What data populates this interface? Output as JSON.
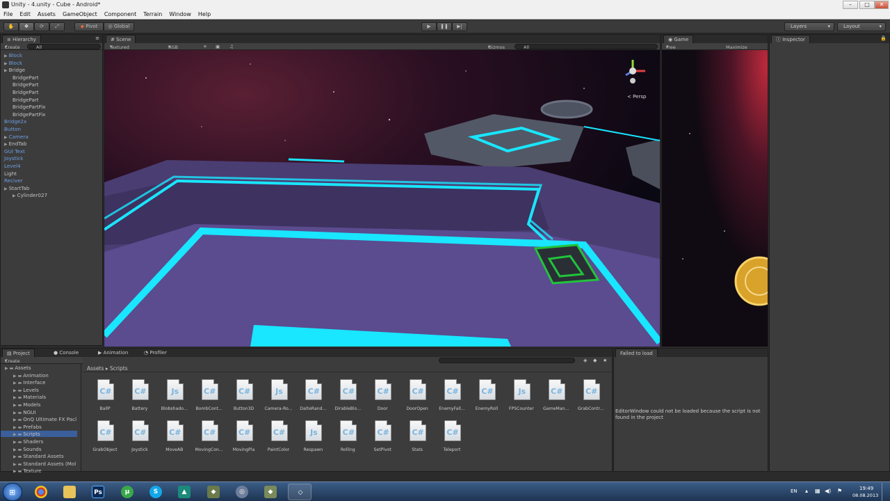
{
  "window": {
    "title": "Unity - 4.unity - Cube - Android*"
  },
  "menu": [
    "File",
    "Edit",
    "Assets",
    "GameObject",
    "Component",
    "Terrain",
    "Window",
    "Help"
  ],
  "toolbar": {
    "pivot": "Pivot",
    "global": "Global",
    "layers": "Layers",
    "layout": "Layout"
  },
  "hierarchy": {
    "tab": "Hierarchy",
    "create": "Create",
    "search": "All",
    "items": [
      {
        "label": "Block",
        "blue": true,
        "indent": 0,
        "arrow": true
      },
      {
        "label": "Block",
        "blue": true,
        "indent": 0,
        "arrow": true
      },
      {
        "label": "Bridge",
        "blue": false,
        "indent": 0,
        "arrow": true
      },
      {
        "label": "BridgePart",
        "blue": false,
        "indent": 1,
        "arrow": false
      },
      {
        "label": "BridgePart",
        "blue": false,
        "indent": 1,
        "arrow": false
      },
      {
        "label": "BridgePart",
        "blue": false,
        "indent": 1,
        "arrow": false
      },
      {
        "label": "BridgePart",
        "blue": false,
        "indent": 1,
        "arrow": false
      },
      {
        "label": "BridgePartFix",
        "blue": false,
        "indent": 1,
        "arrow": false
      },
      {
        "label": "BridgePartFix",
        "blue": false,
        "indent": 1,
        "arrow": false
      },
      {
        "label": "Bridge2x",
        "blue": true,
        "indent": 0,
        "arrow": false
      },
      {
        "label": "Button",
        "blue": true,
        "indent": 0,
        "arrow": false
      },
      {
        "label": "Camera",
        "blue": true,
        "indent": 0,
        "arrow": true
      },
      {
        "label": "EndTab",
        "blue": false,
        "indent": 0,
        "arrow": true
      },
      {
        "label": "GUI Text",
        "blue": true,
        "indent": 0,
        "arrow": false
      },
      {
        "label": "Joystick",
        "blue": true,
        "indent": 0,
        "arrow": false
      },
      {
        "label": "Level4",
        "blue": true,
        "indent": 0,
        "arrow": false
      },
      {
        "label": "Light",
        "blue": false,
        "indent": 0,
        "arrow": false
      },
      {
        "label": "Reciver",
        "blue": true,
        "indent": 0,
        "arrow": false
      },
      {
        "label": "StartTab",
        "blue": false,
        "indent": 0,
        "arrow": true
      },
      {
        "label": "Cylinder027",
        "blue": false,
        "indent": 1,
        "arrow": true
      }
    ]
  },
  "scene": {
    "tab": "Scene",
    "shading": "Textured",
    "render": "RGB",
    "gizmos": "Gizmos",
    "search": "All",
    "persp": "Persp"
  },
  "game": {
    "tab": "Game",
    "aspect": "Free Aspect",
    "maximize": "Maximize on Play"
  },
  "inspector": {
    "tab": "Inspector"
  },
  "bottom_tabs": [
    "Project",
    "Console",
    "Animation",
    "Profiler"
  ],
  "project": {
    "create": "Create",
    "breadcrumb_root": "Assets",
    "breadcrumb_sep": "▸",
    "breadcrumb_current": "Scripts",
    "tree": [
      {
        "label": "Assets",
        "indent": 0
      },
      {
        "label": "Animation",
        "indent": 1
      },
      {
        "label": "Interface",
        "indent": 1
      },
      {
        "label": "Levels",
        "indent": 1
      },
      {
        "label": "Materials",
        "indent": 1
      },
      {
        "label": "Models",
        "indent": 1
      },
      {
        "label": "NGUI",
        "indent": 1
      },
      {
        "label": "OnQ Ultimate FX Pacl",
        "indent": 1
      },
      {
        "label": "Prefabs",
        "indent": 1
      },
      {
        "label": "Scripts",
        "indent": 1,
        "selected": true
      },
      {
        "label": "Shaders",
        "indent": 1
      },
      {
        "label": "Sounds",
        "indent": 1
      },
      {
        "label": "Standard Assets",
        "indent": 1
      },
      {
        "label": "Standard Assets (Mol",
        "indent": 1
      },
      {
        "label": "Texture",
        "indent": 1
      }
    ],
    "assets": [
      {
        "name": "BallP",
        "lang": "C#"
      },
      {
        "name": "Battery",
        "lang": "C#"
      },
      {
        "name": "Blobshado...",
        "lang": "Js"
      },
      {
        "name": "BombCont...",
        "lang": "C#"
      },
      {
        "name": "Button3D",
        "lang": "C#"
      },
      {
        "name": "Camera-Ro...",
        "lang": "Js"
      },
      {
        "name": "DalteRand...",
        "lang": "C#"
      },
      {
        "name": "DirableBlo...",
        "lang": "C#"
      },
      {
        "name": "Door",
        "lang": "C#"
      },
      {
        "name": "DoorOpen",
        "lang": "C#"
      },
      {
        "name": "EnemyFall...",
        "lang": "C#"
      },
      {
        "name": "EnemyRoll",
        "lang": "C#"
      },
      {
        "name": "FPSCounter",
        "lang": "Js"
      },
      {
        "name": "GameMan...",
        "lang": "C#"
      },
      {
        "name": "GrabContr...",
        "lang": "C#"
      },
      {
        "name": "GrabObject",
        "lang": "C#"
      },
      {
        "name": "Joystick",
        "lang": "C#"
      },
      {
        "name": "MoveAB",
        "lang": "C#"
      },
      {
        "name": "MovingCon...",
        "lang": "C#"
      },
      {
        "name": "MovingPla",
        "lang": "C#"
      },
      {
        "name": "PaintColor",
        "lang": "C#"
      },
      {
        "name": "Respawn",
        "lang": "Js"
      },
      {
        "name": "Rolling",
        "lang": "C#"
      },
      {
        "name": "SetPivot",
        "lang": "C#"
      },
      {
        "name": "Stats",
        "lang": "C#"
      },
      {
        "name": "Teleport",
        "lang": "C#"
      }
    ]
  },
  "failed": {
    "tab": "Failed to load",
    "message": "EditorWindow could not be loaded because the script is not found in the project"
  },
  "taskbar": {
    "lang": "EN",
    "time": "19:49",
    "date": "08.08.2013"
  },
  "colors": {
    "neon": "#19e6ff",
    "floor": "#5b4b8f",
    "wall": "#4a3d72",
    "green": "#21c43a"
  }
}
